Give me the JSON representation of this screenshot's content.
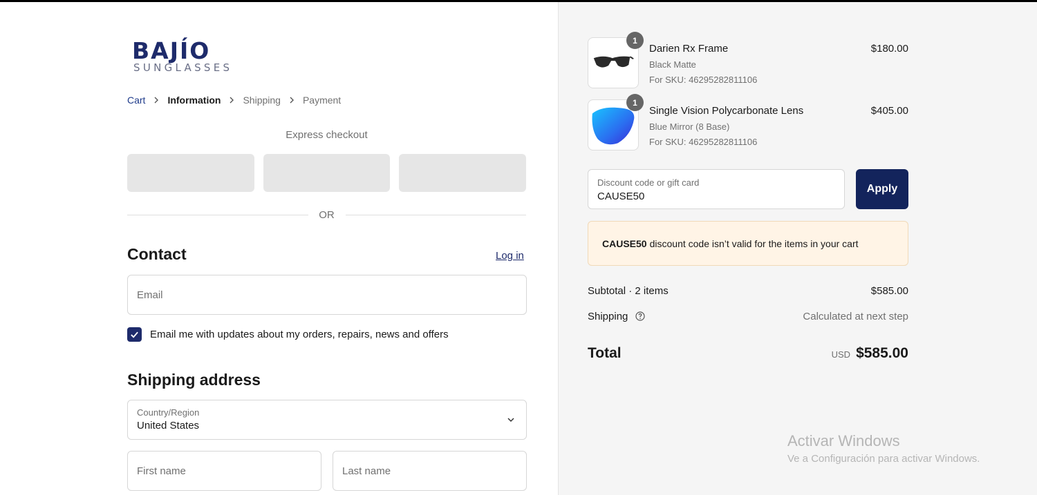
{
  "brand": {
    "logo_main": "BAJÍO",
    "logo_sub": "SUNGLASSES"
  },
  "breadcrumb": {
    "items": [
      {
        "label": "Cart"
      },
      {
        "label": "Information"
      },
      {
        "label": "Shipping"
      },
      {
        "label": "Payment"
      }
    ]
  },
  "express": {
    "title": "Express checkout",
    "or_label": "OR"
  },
  "contact": {
    "title": "Contact",
    "login_label": "Log in",
    "email_placeholder": "Email",
    "newsletter_label": "Email me with updates about my orders, repairs, news and offers",
    "newsletter_checked": true
  },
  "shipping": {
    "title": "Shipping address",
    "country_label": "Country/Region",
    "country_value": "United States",
    "first_name_placeholder": "First name",
    "last_name_placeholder": "Last name"
  },
  "cart": {
    "items": [
      {
        "name": "Darien Rx Frame",
        "variant": "Black Matte",
        "sku": "For SKU: 46295282811106",
        "price": "$180.00",
        "qty": "1",
        "icon": "sunglasses-frame"
      },
      {
        "name": "Single Vision Polycarbonate Lens",
        "variant": "Blue Mirror (8 Base)",
        "sku": "For SKU: 46295282811106",
        "price": "$405.00",
        "qty": "1",
        "icon": "blue-lens"
      }
    ]
  },
  "discount": {
    "label": "Discount code or gift card",
    "value": "CAUSE50",
    "apply_label": "Apply",
    "alert_code": "CAUSE50",
    "alert_text": "discount code isn’t valid for the items in your cart"
  },
  "summary": {
    "subtotal_label": "Subtotal · 2 items",
    "subtotal_value": "$585.00",
    "shipping_label": "Shipping",
    "shipping_value": "Calculated at next step",
    "total_label": "Total",
    "currency": "USD",
    "total_value": "$585.00"
  },
  "watermark": {
    "title": "Activar Windows",
    "subtitle": "Ve a Configuración para activar Windows."
  },
  "colors": {
    "brand_navy": "#1e2b6b",
    "apply_button": "#13245c",
    "alert_bg": "#fff4e6",
    "sidebar_bg": "#f5f5f5"
  }
}
